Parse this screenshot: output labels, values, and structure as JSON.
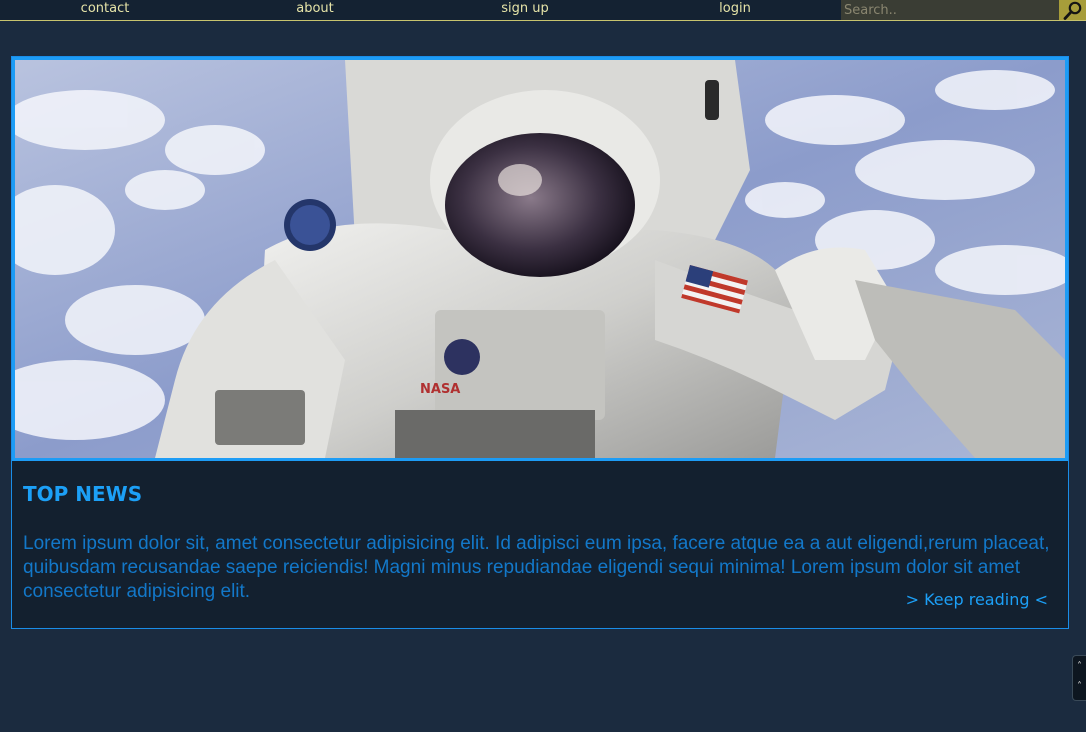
{
  "nav": {
    "links": [
      "contact",
      "about",
      "sign up",
      "login"
    ],
    "search_placeholder": "Search.."
  },
  "article": {
    "title": "TOP NEWS",
    "body": "Lorem ipsum dolor sit, amet consectetur adipisicing elit. Id adipisci eum ipsa, facere atque ea a aut eligendi,rerum placeat, quibusdam recusandae saepe reiciendis! Magni minus repudiandae eligendi sequi minima! Lorem ipsum dolor sit amet consectetur adipisicing elit.",
    "read_more": "> Keep reading <",
    "patch_text": "NASA"
  },
  "scroll": {
    "up_glyph": "˄",
    "down_glyph": "˄"
  },
  "colors": {
    "background": "#1b2b3f",
    "accent": "#1ca0f7",
    "nav_text": "#e6e4a8",
    "search_button": "#a79d3a"
  },
  "icons": {
    "search": "search-icon"
  }
}
